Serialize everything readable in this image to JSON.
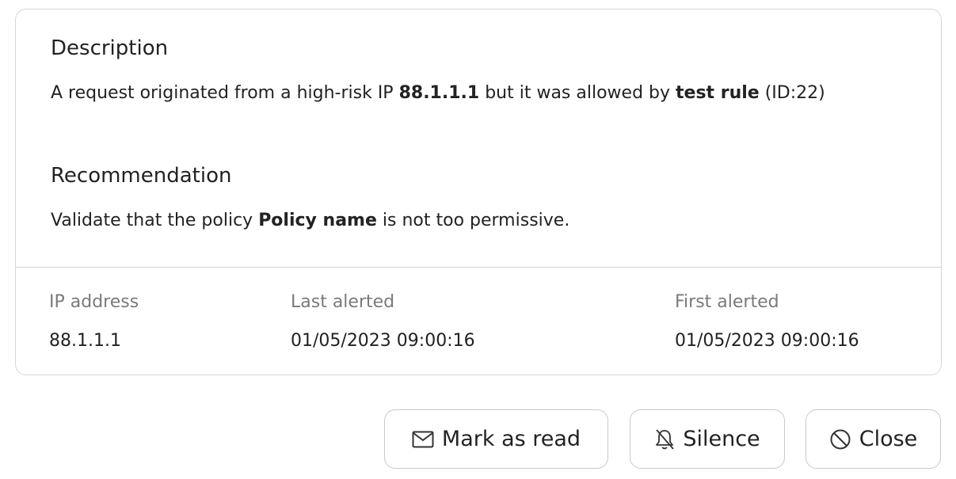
{
  "description": {
    "heading": "Description",
    "text_1": "A request originated from a high-risk IP ",
    "ip": "88.1.1.1",
    "text_2": " but it was allowed by ",
    "rule": "test rule",
    "text_3": " (ID:22)"
  },
  "recommendation": {
    "heading": "Recommendation",
    "text_1": "Validate that the policy ",
    "policy": "Policy name",
    "text_2": " is not too permissive."
  },
  "meta": {
    "ip_label": "IP address",
    "ip_value": "88.1.1.1",
    "last_label": "Last alerted",
    "last_value": "01/05/2023 09:00:16",
    "first_label": "First alerted",
    "first_value": "01/05/2023 09:00:16"
  },
  "actions": {
    "mark_read": {
      "label": "Mark as read",
      "icon": "envelope-icon"
    },
    "silence": {
      "label": "Silence",
      "icon": "bell-off-icon"
    },
    "close": {
      "label": "Close",
      "icon": "ban-icon"
    }
  }
}
